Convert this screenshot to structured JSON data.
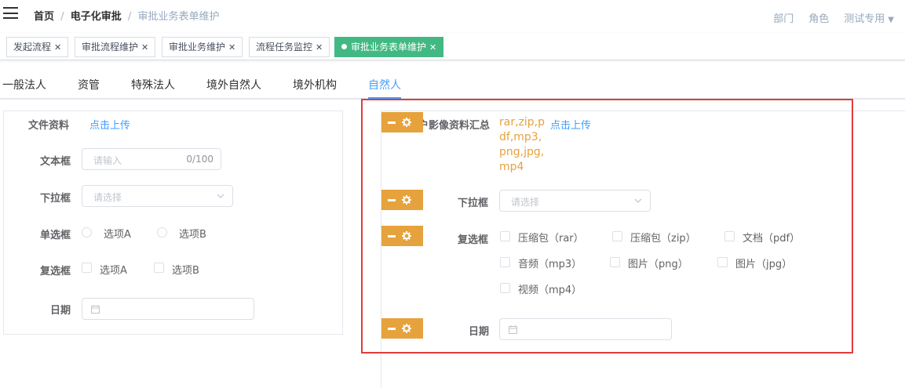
{
  "header": {
    "breadcrumb": [
      "首页",
      "电子化审批",
      "审批业务表单维护"
    ],
    "separator": "/",
    "right_menu": {
      "dept": "部门",
      "role": "角色",
      "user": "测试专用"
    }
  },
  "tags": [
    {
      "label": "发起流程"
    },
    {
      "label": "审批流程维护"
    },
    {
      "label": "审批业务维护"
    },
    {
      "label": "流程任务监控"
    },
    {
      "label": "审批业务表单维护",
      "active": true
    }
  ],
  "tag_close": "✕",
  "entity_tabs": [
    "一般法人",
    "资管",
    "特殊法人",
    "境外自然人",
    "境外机构",
    "自然人"
  ],
  "active_entity_tab": "自然人",
  "left_form": {
    "file_label": "文件资料",
    "upload_link": "点击上传",
    "text_label": "文本框",
    "text_placeholder": "请输入",
    "text_counter": "0/100",
    "select_label": "下拉框",
    "select_placeholder": "请选择",
    "radio_label": "单选框",
    "radio_options": [
      "选项A",
      "选项B"
    ],
    "checkbox_label": "复选框",
    "checkbox_options": [
      "选项A",
      "选项B"
    ],
    "date_label": "日期"
  },
  "right_form": {
    "image_label": "客户影像资料汇总",
    "allowed_formats": "rar,zip,pdf,mp3,png,jpg,mp4",
    "upload_link": "点击上传",
    "select_label": "下拉框",
    "select_placeholder": "请选择",
    "checkbox_label": "复选框",
    "checkbox_options": [
      "压缩包（rar）",
      "压缩包（zip）",
      "文档（pdf）",
      "音频（mp3）",
      "图片（png）",
      "图片（jpg）",
      "视频（mp4）"
    ],
    "date_label": "日期"
  },
  "colors": {
    "accent": "#409eff",
    "active_tag": "#42b983",
    "control_button": "#e6a23c",
    "highlight_border": "#e03c3c"
  }
}
